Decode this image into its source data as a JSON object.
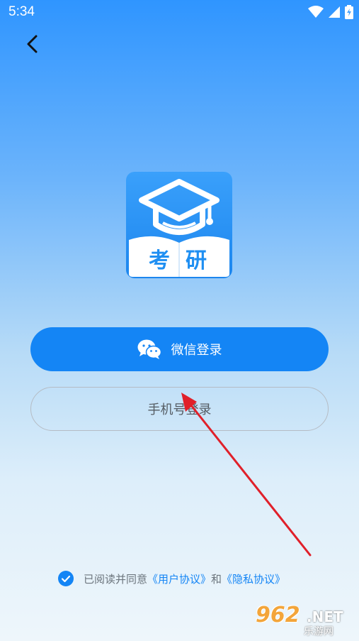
{
  "status_bar": {
    "time": "5:34"
  },
  "logo": {
    "text": "考研"
  },
  "buttons": {
    "wechat_label": "微信登录",
    "phone_label": "手机号登录"
  },
  "agreement": {
    "prefix": "已阅读并同意",
    "user_link": "《用户协议》",
    "conjunction": "和",
    "privacy_link": "《隐私协议》",
    "checked": true
  },
  "watermark": {
    "number": "962",
    "suffix": ".NET",
    "site": "乐游网"
  },
  "colors": {
    "accent": "#1485f5",
    "annotation": "#e0202a"
  }
}
